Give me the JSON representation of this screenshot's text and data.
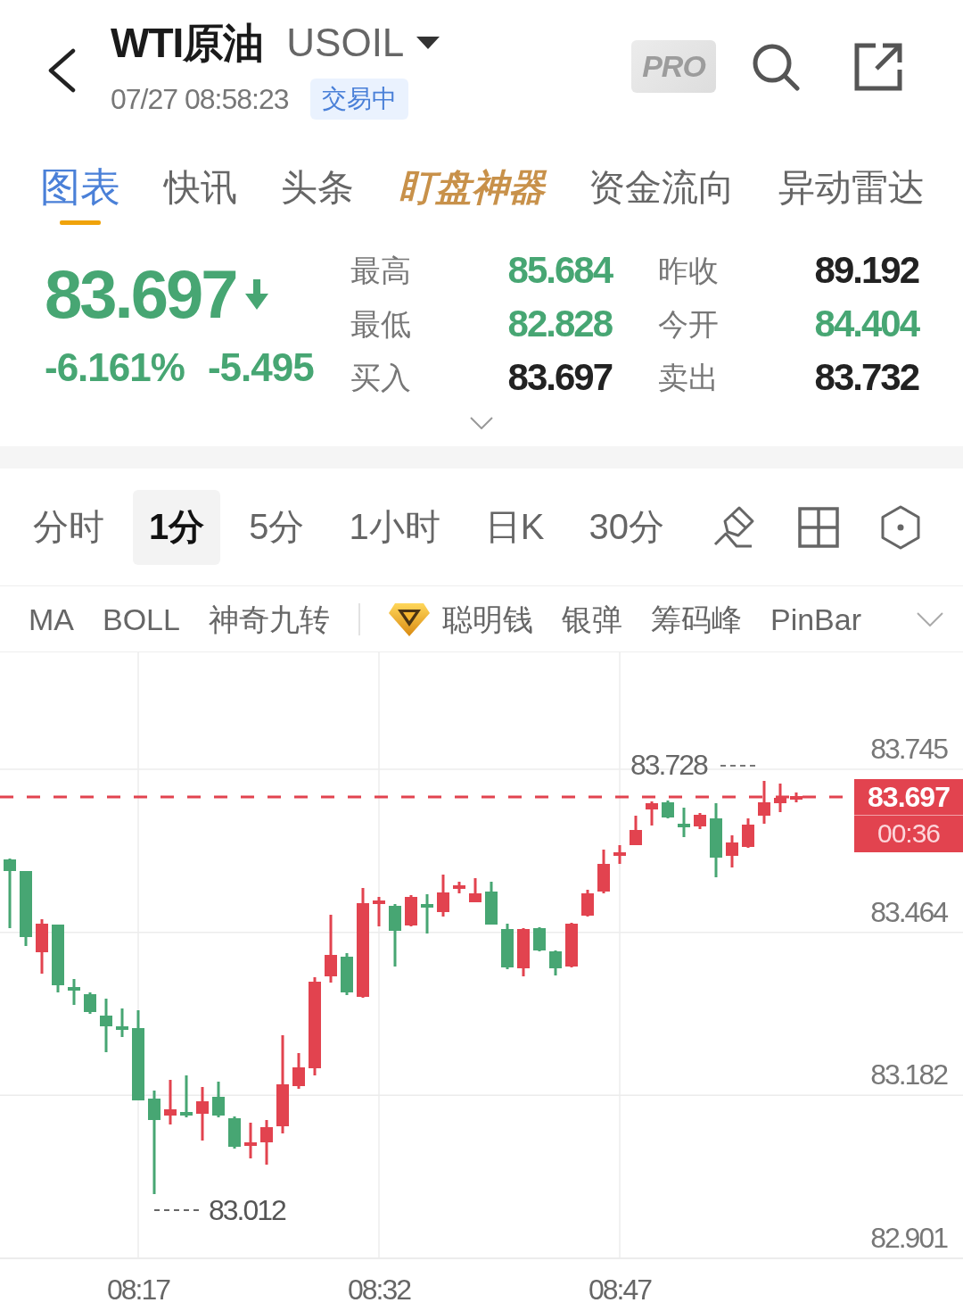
{
  "header": {
    "title": "WTI原油",
    "symbol": "USOIL",
    "timestamp": "07/27 08:58:23",
    "status": "交易中",
    "pro_badge": "PRO"
  },
  "tabs": [
    {
      "label": "图表",
      "selected": true,
      "kind": "plain"
    },
    {
      "label": "快讯",
      "selected": false,
      "kind": "plain"
    },
    {
      "label": "头条",
      "selected": false,
      "kind": "plain"
    },
    {
      "label": "盯盘神器",
      "selected": false,
      "kind": "featured"
    },
    {
      "label": "资金流向",
      "selected": false,
      "kind": "plain"
    },
    {
      "label": "异动雷达",
      "selected": false,
      "kind": "plain"
    }
  ],
  "quote": {
    "price": "83.697",
    "falling": true,
    "change_percent": "-6.161%",
    "change": "-5.495"
  },
  "stats": [
    {
      "label": "最高",
      "value": "85.684",
      "color": "#47a673"
    },
    {
      "label": "昨收",
      "value": "89.192",
      "color": "#222222"
    },
    {
      "label": "最低",
      "value": "82.828",
      "color": "#47a673"
    },
    {
      "label": "今开",
      "value": "84.404",
      "color": "#47a673"
    },
    {
      "label": "买入",
      "value": "83.697",
      "color": "#222222"
    },
    {
      "label": "卖出",
      "value": "83.732",
      "color": "#222222"
    }
  ],
  "periods": [
    {
      "label": "分时",
      "selected": false
    },
    {
      "label": "1分",
      "selected": true
    },
    {
      "label": "5分",
      "selected": false
    },
    {
      "label": "1小时",
      "selected": false
    },
    {
      "label": "日K",
      "selected": false
    },
    {
      "label": "30分",
      "selected": false
    }
  ],
  "indicators": [
    {
      "label": "MA",
      "kind": "basic"
    },
    {
      "label": "BOLL",
      "kind": "basic"
    },
    {
      "label": "神奇九转",
      "kind": "basic"
    },
    {
      "label": "聪明钱",
      "kind": "premium"
    },
    {
      "label": "银弹",
      "kind": "basic"
    },
    {
      "label": "筹码峰",
      "kind": "basic"
    },
    {
      "label": "PinBar",
      "kind": "basic"
    }
  ],
  "chart": {
    "price_axis": [
      "83.745",
      "83.464",
      "83.182",
      "82.901"
    ],
    "time_axis": [
      "08:17",
      "08:32",
      "08:47"
    ],
    "high_label": "83.728",
    "low_label": "83.012",
    "last_price": "83.697",
    "countdown": "00:36"
  }
}
